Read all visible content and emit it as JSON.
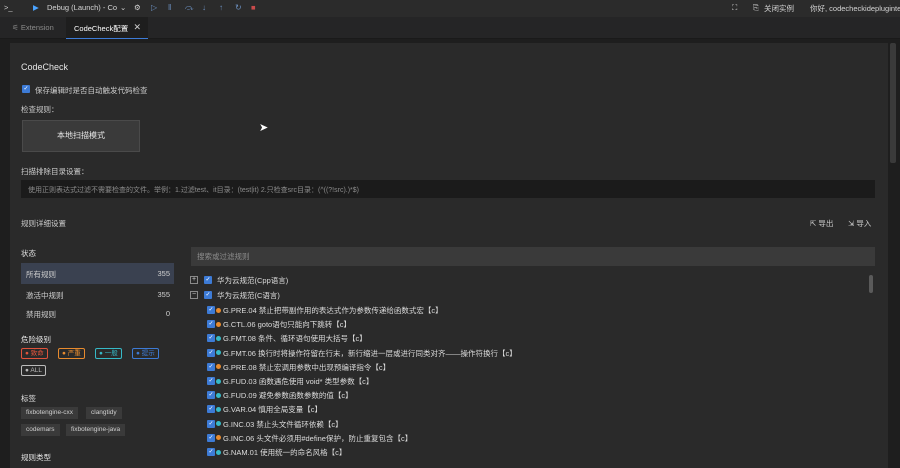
{
  "topbar": {
    "config_name": "Debug (Launch) - Co",
    "close_instance_label": "关闭实例",
    "user_greeting": "你好, codecheckideplugintes"
  },
  "tabs": [
    {
      "label": "Extension"
    },
    {
      "label": "CodeCheck配置"
    }
  ],
  "page": {
    "title": "CodeCheck",
    "auto_check_label": "保存编辑时是否自动触发代码检查",
    "check_rules_label": "检查规则：",
    "scan_mode_button": "本地扫描模式",
    "exclude_label": "扫描排除目录设置：",
    "exclude_placeholder": "使用正则表达式过滤不需要检查的文件。举例：1.过滤test、it目录：(test|it) 2.只检查src目录：(^((?!src).)*$)",
    "rule_details_label": "规则详细设置",
    "export_label": "导出",
    "import_label": "导入",
    "rule_search_placeholder": "搜索或过滤规则"
  },
  "status": {
    "heading": "状态",
    "rows": [
      {
        "label": "所有规则",
        "count": "355"
      },
      {
        "label": "激活中规则",
        "count": "355"
      },
      {
        "label": "禁用规则",
        "count": "0"
      }
    ]
  },
  "severity": {
    "heading": "危险级别",
    "chips": [
      {
        "label": "致命",
        "color": "#e0533b"
      },
      {
        "label": "严重",
        "color": "#e88b2e"
      },
      {
        "label": "一般",
        "color": "#36b9c7"
      },
      {
        "label": "提示",
        "color": "#3d7bd6"
      },
      {
        "label": "ALL",
        "color": "#bbbbbb"
      }
    ]
  },
  "tags": {
    "heading": "标签",
    "items": [
      "fixbotengine-cxx",
      "clangtidy",
      "codemars",
      "fixbotengine-java"
    ]
  },
  "rule_type": {
    "heading": "规则类型"
  },
  "tree": {
    "groups": [
      {
        "label": "华为云规范(Cpp语言)",
        "expander": "+"
      },
      {
        "label": "华为云规范(C语言)",
        "expander": "−"
      }
    ],
    "rules": [
      {
        "text": "G.PRE.04 禁止把带副作用的表达式作为参数传递给函数式宏【c】",
        "color": "#e88b2e"
      },
      {
        "text": "G.CTL.06 goto语句只能向下跳转【c】",
        "color": "#e88b2e"
      },
      {
        "text": "G.FMT.08 条件、循环语句使用大括号【c】",
        "color": "#36b9c7"
      },
      {
        "text": "G.FMT.06 换行时将操作符留在行末，新行缩进一层或进行同类对齐——操作符换行【c】",
        "color": "#36b9c7"
      },
      {
        "text": "G.PRE.08 禁止宏调用参数中出现预编译指令【c】",
        "color": "#e88b2e"
      },
      {
        "text": "G.FUD.03 函数遇危使用 void* 类型参数【c】",
        "color": "#36b9c7"
      },
      {
        "text": "G.FUD.09 避免参数函数参数的值【c】",
        "color": "#36b9c7"
      },
      {
        "text": "G.VAR.04 慎用全局变量【c】",
        "color": "#36b9c7"
      },
      {
        "text": "G.INC.03 禁止头文件循环依赖【c】",
        "color": "#36b9c7"
      },
      {
        "text": "G.INC.06 头文件必须用#define保护，防止重复包含【c】",
        "color": "#e88b2e"
      },
      {
        "text": "G.NAM.01 使用统一的命名风格【c】",
        "color": "#36b9c7"
      }
    ]
  }
}
